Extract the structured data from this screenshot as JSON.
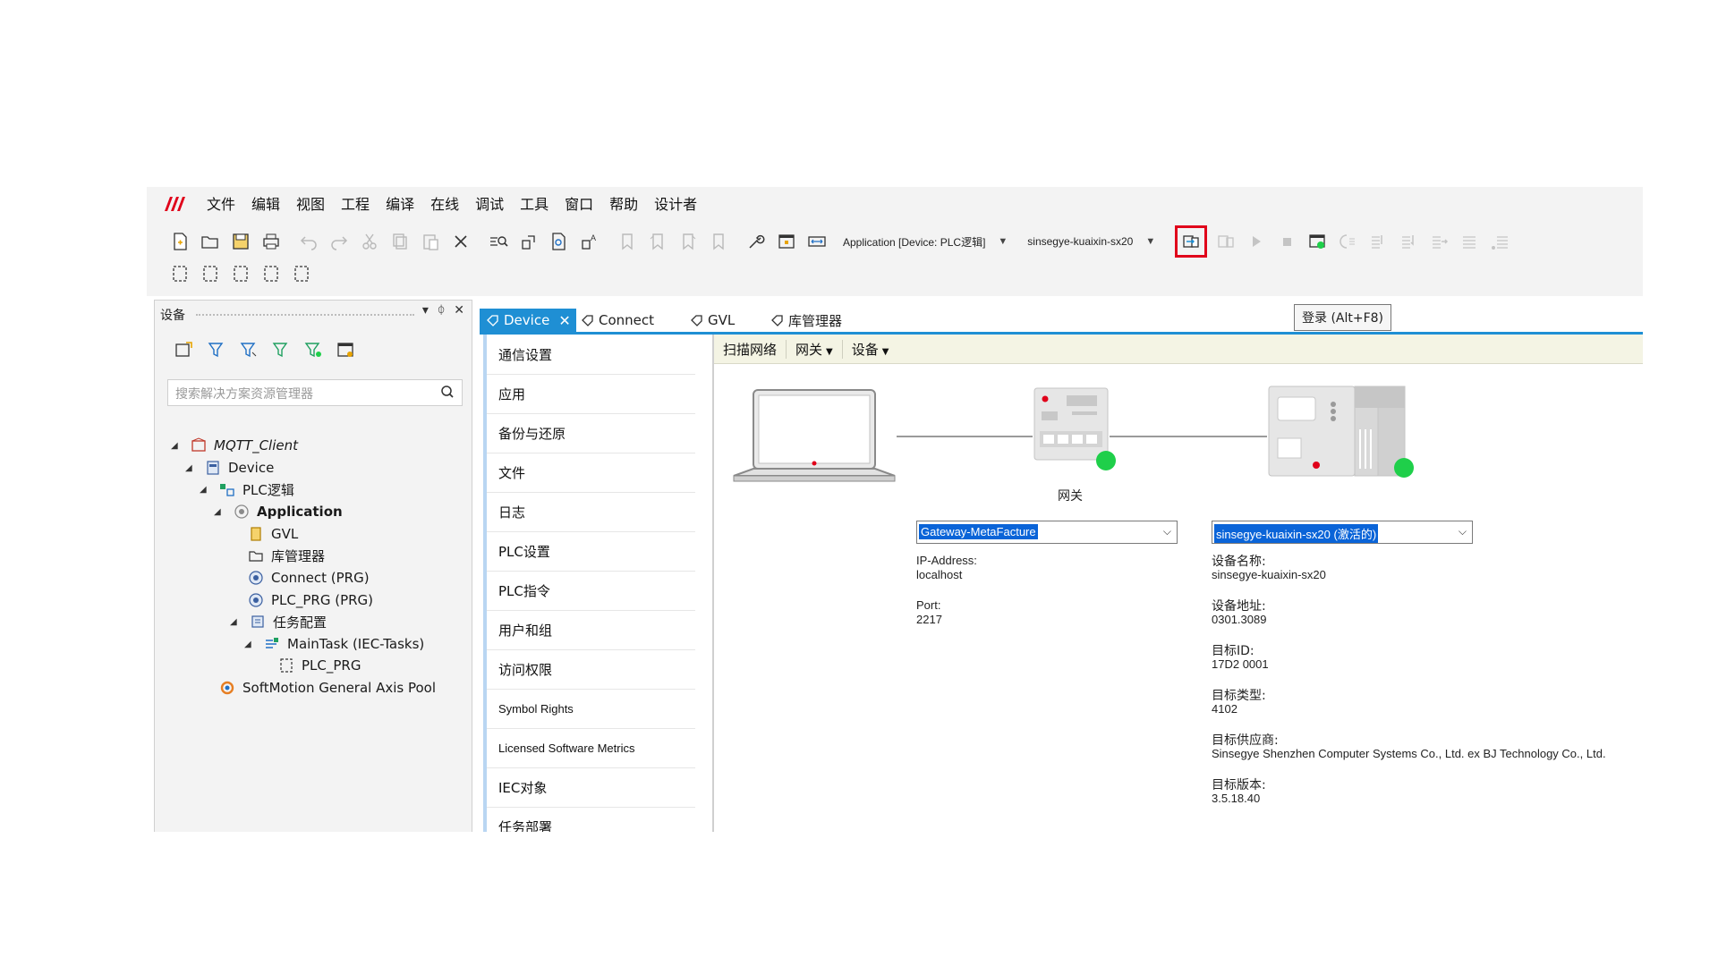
{
  "menu": {
    "items": [
      "文件",
      "编辑",
      "视图",
      "工程",
      "编译",
      "在线",
      "调试",
      "工具",
      "窗口",
      "帮助",
      "设计者"
    ]
  },
  "toolbar": {
    "app_combo": "Application [Device: PLC逻辑]",
    "device_combo": "sinsegye-kuaixin-sx20",
    "login_tooltip": "登录 (Alt+F8)"
  },
  "left_panel": {
    "title": "设备",
    "pin": "ᛰ",
    "close": "✕",
    "search_placeholder": "搜索解决方案资源管理器",
    "tree": [
      {
        "label": "MQTT_Client",
        "italic": true
      },
      {
        "label": "Device"
      },
      {
        "label": "PLC逻辑"
      },
      {
        "label": "Application",
        "bold": true
      },
      {
        "label": "GVL"
      },
      {
        "label": "库管理器"
      },
      {
        "label": "Connect (PRG)"
      },
      {
        "label": "PLC_PRG (PRG)"
      },
      {
        "label": "任务配置"
      },
      {
        "label": "MainTask (IEC-Tasks)"
      },
      {
        "label": "PLC_PRG"
      },
      {
        "label": "SoftMotion General Axis Pool"
      }
    ]
  },
  "tabs": [
    {
      "label": "Device",
      "active": true
    },
    {
      "label": "Connect"
    },
    {
      "label": "GVL"
    },
    {
      "label": "库管理器"
    }
  ],
  "nav": {
    "items": [
      "通信设置",
      "应用",
      "备份与还原",
      "文件",
      "日志",
      "PLC设置",
      "PLC指令",
      "用户和组",
      "访问权限",
      "Symbol Rights",
      "Licensed Software Metrics",
      "IEC对象",
      "任务部署"
    ]
  },
  "strip": {
    "scan": "扫描网络",
    "gateway": "网关",
    "device": "设备"
  },
  "gateway": {
    "label": "网关",
    "selected": "Gateway-MetaFacture",
    "ip_label": "IP-Address:",
    "ip_value": "localhost",
    "port_label": "Port:",
    "port_value": "2217"
  },
  "device": {
    "selected": "sinsegye-kuaixin-sx20 (激活的)",
    "name_label": "设备名称:",
    "name_value": "sinsegye-kuaixin-sx20",
    "addr_label": "设备地址:",
    "addr_value": "0301.3089",
    "target_id_label": "目标ID:",
    "target_id_value": "17D2 0001",
    "target_type_label": "目标类型:",
    "target_type_value": "4102",
    "vendor_label": "目标供应商:",
    "vendor_value": "Sinsegye Shenzhen Computer Systems Co., Ltd. ex BJ Technology Co., Ltd.",
    "version_label": "目标版本:",
    "version_value": "3.5.18.40"
  },
  "colors": {
    "accent": "#1f8fd4",
    "login_highlight": "#e0001a",
    "status_ok": "#1fcf4a",
    "selection": "#0a64d8"
  }
}
